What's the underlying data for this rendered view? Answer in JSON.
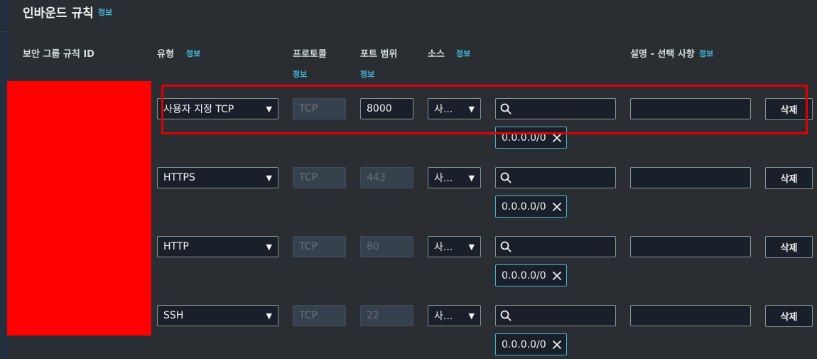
{
  "header": {
    "title": "인바운드 규칙",
    "info": "정보"
  },
  "columns": {
    "rule_id": "보안 그룹 규칙 ID",
    "type": "유형",
    "type_info": "정보",
    "protocol": "프로토콜",
    "protocol_info": "정보",
    "port_range": "포트 범위",
    "port_info": "정보",
    "source": "소스",
    "source_info": "정보",
    "description": "설명 - 선택 사항",
    "description_info": "정보"
  },
  "rules": [
    {
      "type": "사용자 지정 TCP",
      "protocol": "TCP",
      "port": "8000",
      "port_editable": true,
      "source": "사...",
      "cidr": "0.0.0.0/0",
      "description": "",
      "delete": "삭제"
    },
    {
      "type": "HTTPS",
      "protocol": "TCP",
      "port": "443",
      "port_editable": false,
      "source": "사...",
      "cidr": "0.0.0.0/0",
      "description": "",
      "delete": "삭제"
    },
    {
      "type": "HTTP",
      "protocol": "TCP",
      "port": "80",
      "port_editable": false,
      "source": "사...",
      "cidr": "0.0.0.0/0",
      "description": "",
      "delete": "삭제"
    },
    {
      "type": "SSH",
      "protocol": "TCP",
      "port": "22",
      "port_editable": false,
      "source": "사...",
      "cidr": "0.0.0.0/0",
      "description": "",
      "delete": "삭제"
    }
  ],
  "colors": {
    "accent": "#44b9d6",
    "highlight": "#e00000",
    "redaction": "#ff0000"
  },
  "icons": {
    "dropdown": "caret-down-icon",
    "search": "search-icon",
    "remove": "close-icon"
  }
}
